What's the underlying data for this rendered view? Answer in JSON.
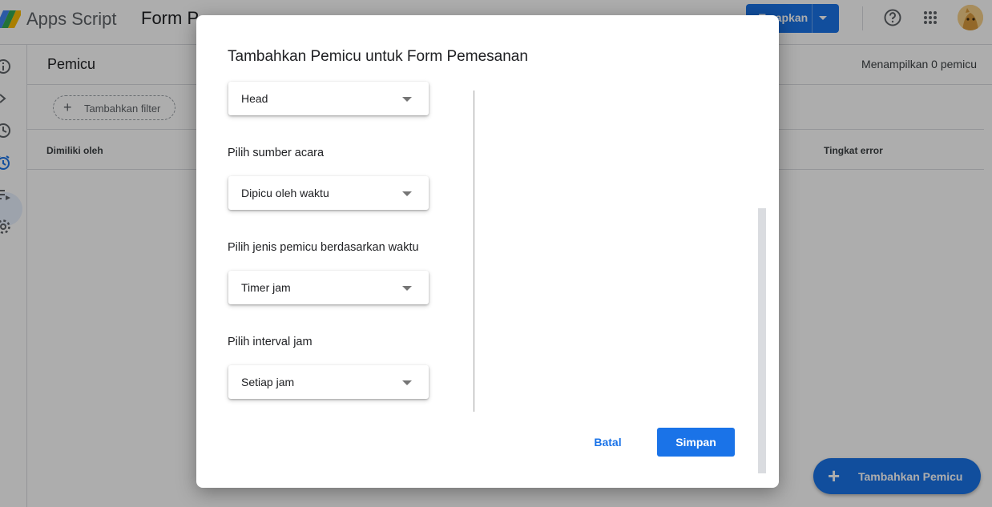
{
  "header": {
    "app_name": "Apps Script",
    "project_title": "Form P",
    "deploy_label": "Terapkan"
  },
  "page": {
    "title": "Pemicu",
    "trigger_count": "Menampilkan 0 pemicu",
    "filter_label": "Tambahkan filter",
    "columns": {
      "owner": "Dimiliki oleh",
      "error_rate": "Tingkat error"
    },
    "fab_label": "Tambahkan Pemicu"
  },
  "dialog": {
    "title": "Tambahkan Pemicu untuk Form Pemesanan",
    "deployment_value": "Head",
    "event_source_label": "Pilih sumber acara",
    "event_source_value": "Dipicu oleh waktu",
    "trigger_type_label": "Pilih jenis pemicu berdasarkan waktu",
    "trigger_type_value": "Timer jam",
    "interval_label": "Pilih interval jam",
    "interval_value": "Setiap jam",
    "cancel_label": "Batal",
    "save_label": "Simpan"
  },
  "colors": {
    "accent": "#1a73e8",
    "scrim": "rgba(0,0,0,0.32)"
  },
  "icons": {
    "logo": "apps-script-logo",
    "help": "help-icon",
    "apps": "apps-grid-icon",
    "nav": [
      "info-icon",
      "code-icon",
      "history-icon",
      "triggers-icon",
      "executions-icon",
      "settings-icon"
    ]
  }
}
